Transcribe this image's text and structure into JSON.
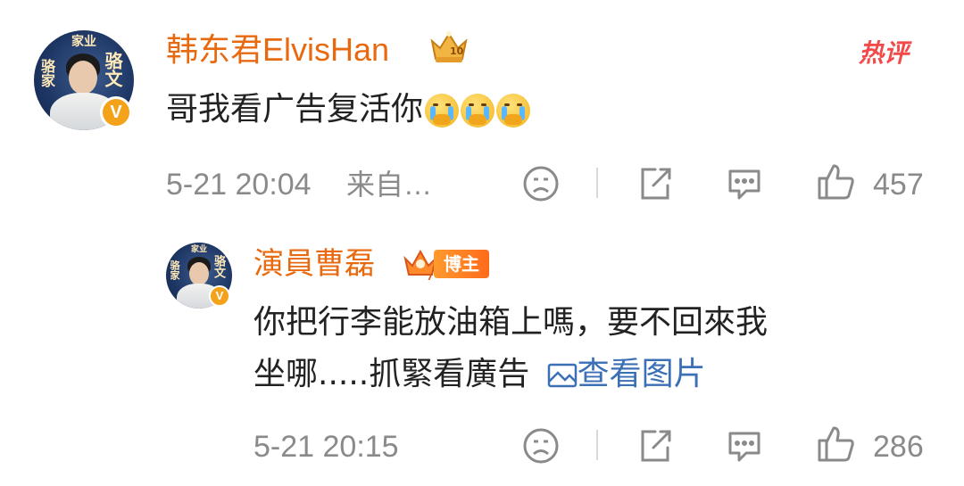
{
  "hot_tag": "热评",
  "comment": {
    "username": "韩东君ElvisHan",
    "text": "哥我看广告复活你",
    "emojis": [
      "crying-face-icon",
      "crying-face-icon",
      "crying-face-icon"
    ],
    "timestamp": "5-21 20:04",
    "source": "来自…",
    "likes": "457",
    "avatar_calligraphy": [
      "家业",
      "骆文",
      "骆家"
    ]
  },
  "reply": {
    "username": "演員曹磊",
    "badge": "博主",
    "text_line1": "你把行李能放油箱上嗎，要不回來我",
    "text_line2": "坐哪.....抓緊看廣告",
    "view_image_label": "查看图片",
    "timestamp": "5-21 20:15",
    "likes": "286",
    "avatar_calligraphy": [
      "家业",
      "骆文",
      "骆家"
    ]
  },
  "colors": {
    "username": "#e86a10",
    "meta": "#8a8a8a",
    "link": "#3b6fb6",
    "hot": "#f24a4a",
    "verified": "#f5a21b"
  }
}
